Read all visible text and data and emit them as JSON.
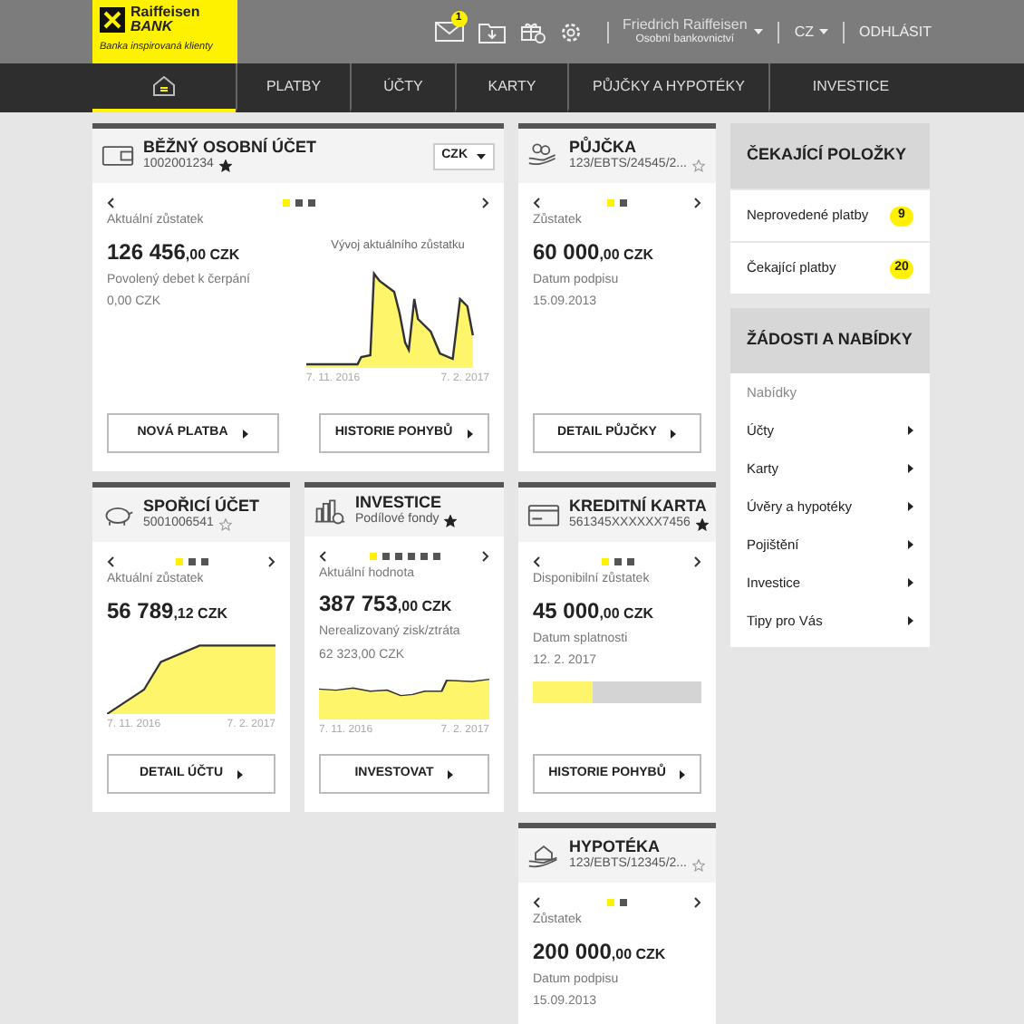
{
  "logo": {
    "name": "Raiffeisen",
    "name_line2": "BANK",
    "tagline": "Banka inspirovaná klienty"
  },
  "header": {
    "mail_count": "1",
    "user_name": "Friedrich Raiffeisen",
    "user_segment": "Osobní bankovnictví",
    "language": "CZ",
    "logout": "ODHLÁSIT"
  },
  "nav": [
    {
      "kind": "home",
      "selected": true
    },
    {
      "label": "PLATBY",
      "selected": false
    },
    {
      "label": "ÚČTY",
      "selected": false
    },
    {
      "label": "KARTY",
      "selected": false
    },
    {
      "label": "PŮJČKY A HYPOTÉKY",
      "selected": false
    },
    {
      "label": "INVESTICE",
      "selected": false
    }
  ],
  "cards": [
    {
      "title": "BĚŽNÝ OSOBNÍ ÚČET",
      "subtitle": "1002001234",
      "favorite": true,
      "currency": "CZK",
      "dots": [
        {
          "selected": true
        },
        {
          "selected": false
        },
        {
          "selected": false
        }
      ],
      "lines": [
        {
          "kind": "label",
          "text": "Aktuální zůstatek"
        },
        {
          "kind": "amount",
          "text": "126 456",
          "fraction": ",00 CZK"
        },
        {
          "kind": "label",
          "text": "Povolený debet k čerpání"
        },
        {
          "kind": "value",
          "text": "0,00 CZK"
        }
      ],
      "chart": {
        "title": "Vývoj aktuálního zůstatku",
        "start": "7. 11. 2016",
        "end": "7. 2. 2017"
      },
      "buttons": [
        "NOVÁ PLATBA",
        "HISTORIE POHYBŮ"
      ]
    },
    {
      "title": "PŮJČKA",
      "subtitle": "123/EBTS/24545/2...",
      "favorite": false,
      "dots": [
        {
          "selected": true
        },
        {
          "selected": false
        }
      ],
      "lines": [
        {
          "kind": "label",
          "text": "Zůstatek"
        },
        {
          "kind": "amount",
          "text": "60 000",
          "fraction": ",00 CZK"
        },
        {
          "kind": "label",
          "text": "Datum podpisu"
        },
        {
          "kind": "value",
          "text": "15.09.2013"
        }
      ],
      "buttons": [
        "DETAIL PŮJČKY"
      ]
    },
    {
      "title": "SPOŘICÍ ÚČET",
      "subtitle": "5001006541",
      "favorite": false,
      "dots": [
        {
          "selected": true
        },
        {
          "selected": false
        },
        {
          "selected": false
        }
      ],
      "lines": [
        {
          "kind": "label",
          "text": "Aktuální zůstatek"
        },
        {
          "kind": "amount",
          "text": "56 789",
          "fraction": ",12 CZK"
        }
      ],
      "chart": {
        "start": "7. 11. 2016",
        "end": "7. 2. 2017"
      },
      "buttons": [
        "DETAIL ÚČTU"
      ]
    },
    {
      "title": "INVESTICE",
      "subtitle": "Podílové fondy",
      "favorite": true,
      "dots": [
        {
          "selected": true
        },
        {
          "selected": false
        },
        {
          "selected": false
        },
        {
          "selected": false
        },
        {
          "selected": false
        },
        {
          "selected": false
        }
      ],
      "lines": [
        {
          "kind": "label",
          "text": "Aktuální hodnota"
        },
        {
          "kind": "amount",
          "text": "387 753",
          "fraction": ",00 CZK"
        },
        {
          "kind": "label",
          "text": "Nerealizovaný zisk/ztráta"
        },
        {
          "kind": "value",
          "text": "62 323,00 CZK"
        }
      ],
      "chart": {
        "start": "7. 11. 2016",
        "end": "7. 2. 2017"
      },
      "buttons": [
        "INVESTOVAT"
      ]
    },
    {
      "title": "KREDITNÍ KARTA",
      "subtitle": "561345XXXXXX7456",
      "favorite": true,
      "dots": [
        {
          "selected": true
        },
        {
          "selected": false
        },
        {
          "selected": false
        }
      ],
      "lines": [
        {
          "kind": "label",
          "text": "Disponibilní zůstatek"
        },
        {
          "kind": "amount",
          "text": "45 000",
          "fraction": ",00 CZK"
        },
        {
          "kind": "label",
          "text": "Datum splatnosti"
        },
        {
          "kind": "value",
          "text": "12. 2. 2017"
        }
      ],
      "bar": {
        "level": 0.35
      },
      "buttons": [
        "HISTORIE POHYBŮ"
      ]
    },
    {
      "title": "HYPOTÉKA",
      "subtitle": "123/EBTS/12345/2...",
      "favorite": false,
      "dots": [
        {
          "selected": true
        },
        {
          "selected": false
        }
      ],
      "lines": [
        {
          "kind": "label",
          "text": "Zůstatek"
        },
        {
          "kind": "amount",
          "text": "200 000",
          "fraction": ",00 CZK"
        },
        {
          "kind": "label",
          "text": "Datum podpisu"
        },
        {
          "kind": "value",
          "text": "15.09.2013"
        }
      ]
    }
  ],
  "pending": {
    "title": "ČEKAJÍCÍ POLOŽKY",
    "items": [
      {
        "label": "Neprovedené platby",
        "count": "9"
      },
      {
        "label": "Čekající platby",
        "count": "20"
      }
    ]
  },
  "requests": {
    "title": "ŽÁDOSTI A NABÍDKY",
    "section": "Nabídky",
    "items": [
      "Účty",
      "Karty",
      "Úvěry a hypotéky",
      "Pojištění",
      "Investice",
      "Tipy pro Vás"
    ]
  }
}
